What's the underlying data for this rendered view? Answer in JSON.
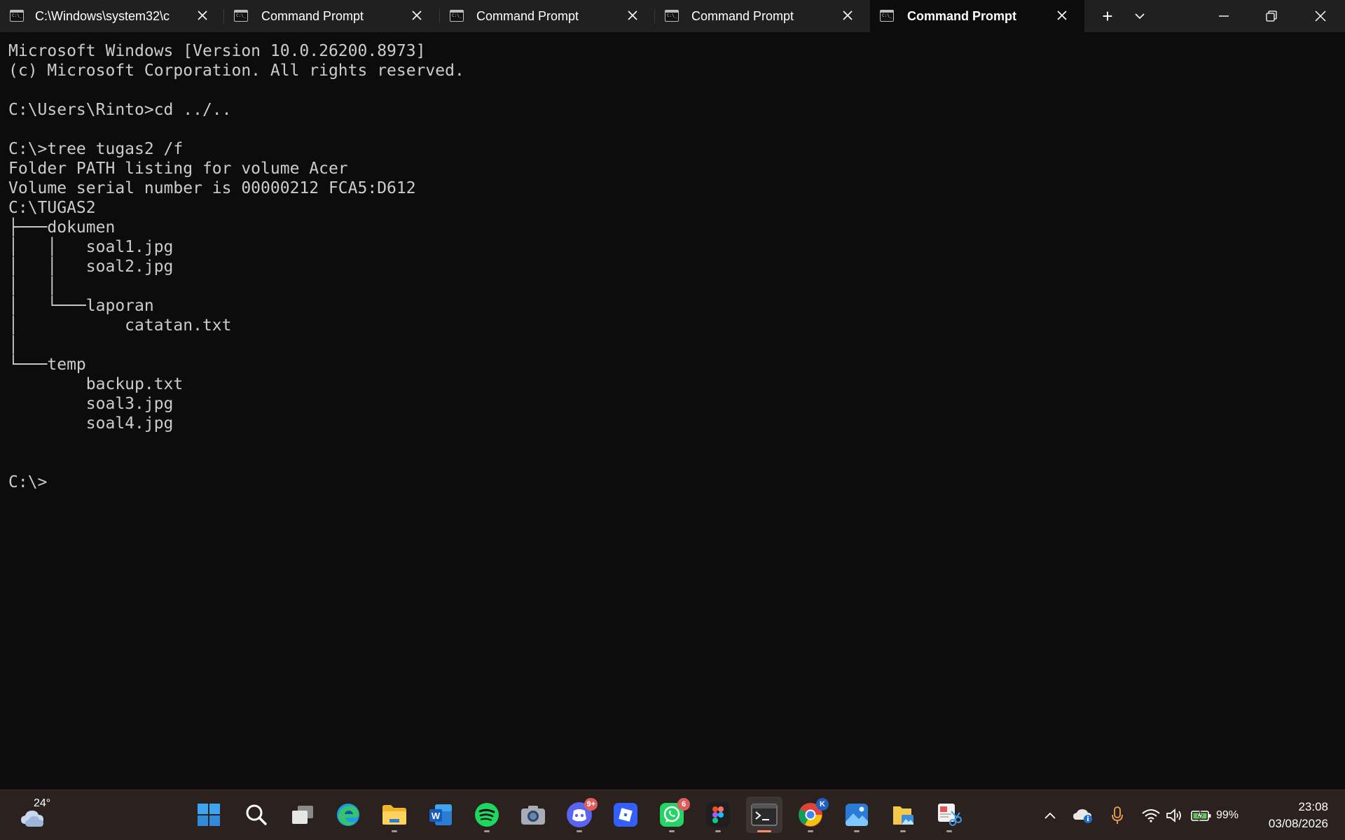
{
  "tabs": [
    {
      "title": "C:\\Windows\\system32\\c",
      "active": false
    },
    {
      "title": "Command Prompt",
      "active": false
    },
    {
      "title": "Command Prompt",
      "active": false
    },
    {
      "title": "Command Prompt",
      "active": false
    },
    {
      "title": "Command Prompt",
      "active": true
    }
  ],
  "titlebar": {
    "new_tab": "+",
    "dropdown": "chevron-down-icon",
    "minimize": "minimize-icon",
    "maximize": "restore-icon",
    "close": "close-icon"
  },
  "terminal": {
    "lines": [
      "Microsoft Windows [Version 10.0.26200.8973]",
      "(c) Microsoft Corporation. All rights reserved.",
      "",
      "C:\\Users\\Rinto>cd ../..",
      "",
      "C:\\>tree tugas2 /f",
      "Folder PATH listing for volume Acer",
      "Volume serial number is 00000212 FCA5:D612",
      "C:\\TUGAS2",
      "├───dokumen",
      "│   │   soal1.jpg",
      "│   │   soal2.jpg",
      "│   │",
      "│   └───laporan",
      "│           catatan.txt",
      "│",
      "└───temp",
      "        backup.txt",
      "        soal3.jpg",
      "        soal4.jpg",
      "",
      "",
      "C:\\>"
    ]
  },
  "taskbar": {
    "weather": {
      "temp": "24°"
    },
    "apps": [
      {
        "name": "start",
        "icon": "windows-icon"
      },
      {
        "name": "search",
        "icon": "search-icon"
      },
      {
        "name": "task-view",
        "icon": "task-view-icon"
      },
      {
        "name": "edge",
        "icon": "edge-icon"
      },
      {
        "name": "file-explorer",
        "icon": "folder-icon"
      },
      {
        "name": "word",
        "icon": "word-icon"
      },
      {
        "name": "spotify",
        "icon": "spotify-icon"
      },
      {
        "name": "camera",
        "icon": "camera-icon"
      },
      {
        "name": "discord",
        "icon": "discord-icon",
        "badge": "9+"
      },
      {
        "name": "roblox",
        "icon": "roblox-icon"
      },
      {
        "name": "whatsapp",
        "icon": "whatsapp-icon",
        "badge": "6"
      },
      {
        "name": "figma",
        "icon": "figma-icon"
      },
      {
        "name": "terminal",
        "icon": "terminal-icon"
      },
      {
        "name": "chrome",
        "icon": "chrome-icon",
        "badge": "K"
      },
      {
        "name": "photos",
        "icon": "photos-icon"
      },
      {
        "name": "sticky-folder",
        "icon": "folder-image-icon"
      },
      {
        "name": "snipping-tool",
        "icon": "snipping-tool-icon"
      }
    ],
    "tray": {
      "battery": "99%",
      "time": "23:08",
      "date": "03/08/2026"
    }
  },
  "colors": {
    "terminal_bg": "#0c0c0c",
    "terminal_fg": "#cccccc",
    "titlebar_bg": "#202020",
    "taskbar_bg": "#2b2220",
    "active_indicator": "#ff8c6b"
  }
}
